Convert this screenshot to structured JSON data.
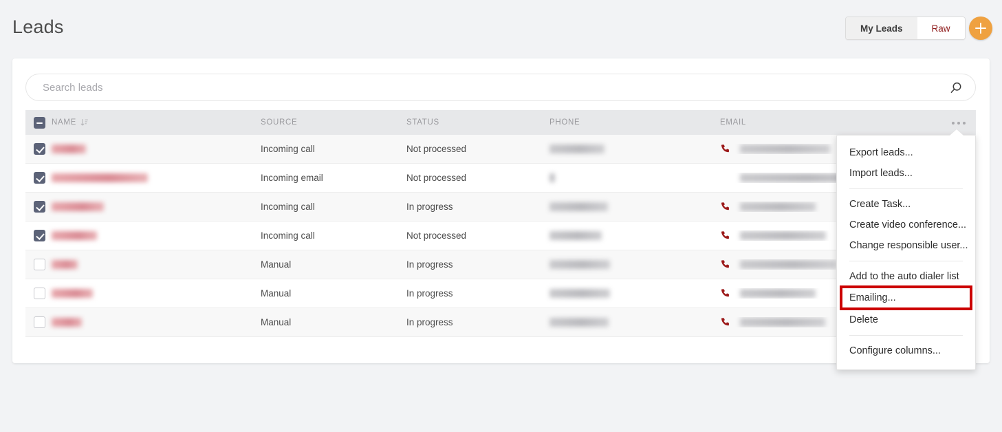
{
  "header": {
    "title": "Leads",
    "toggle": {
      "options": [
        "My Leads",
        "Raw"
      ],
      "selected": "My Leads"
    },
    "add_button_label": "+",
    "add_button_color": "#efa140",
    "raw_text_color": "#8e1a1a"
  },
  "search": {
    "placeholder": "Search leads",
    "value": "",
    "icon": "search-icon"
  },
  "table": {
    "columns": [
      "NAME",
      "SOURCE",
      "STATUS",
      "PHONE",
      "EMAIL"
    ],
    "sort_column": "NAME",
    "sort_icon": "sort-descending-icon",
    "header_checkbox_state": "indeterminate",
    "overflow_menu_icon": "ellipsis-icon",
    "rows": [
      {
        "checked": true,
        "name": "[redacted]",
        "name_width": 50,
        "source": "Incoming call",
        "status": "Not processed",
        "phone": "[redacted]",
        "phone_width": 80,
        "has_phone_icon": true,
        "email": "[redacted]",
        "email_width": 131
      },
      {
        "checked": true,
        "name": "[redacted]",
        "name_width": 140,
        "source": "Incoming email",
        "status": "Not processed",
        "phone": "",
        "phone_width": 8,
        "has_phone_icon": false,
        "email": "[redacted]",
        "email_width": 178
      },
      {
        "checked": true,
        "name": "[redacted]",
        "name_width": 76,
        "source": "Incoming call",
        "status": "In progress",
        "phone": "[redacted]",
        "phone_width": 85,
        "has_phone_icon": true,
        "email": "[redacted]",
        "email_width": 110
      },
      {
        "checked": true,
        "name": "[redacted]",
        "name_width": 66,
        "source": "Incoming call",
        "status": "Not processed",
        "phone": "[redacted]",
        "phone_width": 76,
        "has_phone_icon": true,
        "email": "[redacted]",
        "email_width": 125
      },
      {
        "checked": false,
        "name": "[redacted]",
        "name_width": 38,
        "source": "Manual",
        "status": "In progress",
        "phone": "[redacted]",
        "phone_width": 88,
        "has_phone_icon": true,
        "email": "[redacted]",
        "email_width": 140
      },
      {
        "checked": false,
        "name": "[redacted]",
        "name_width": 60,
        "source": "Manual",
        "status": "In progress",
        "phone": "[redacted]",
        "phone_width": 88,
        "has_phone_icon": true,
        "email": "[redacted]",
        "email_width": 110
      },
      {
        "checked": false,
        "name": "[redacted]",
        "name_width": 44,
        "source": "Manual",
        "status": "In progress",
        "phone": "[redacted]",
        "phone_width": 86,
        "has_phone_icon": true,
        "email": "[redacted]",
        "email_width": 124
      }
    ]
  },
  "context_menu": {
    "groups": [
      {
        "items": [
          {
            "label": "Export leads...",
            "highlighted": false
          },
          {
            "label": "Import leads...",
            "highlighted": false
          }
        ]
      },
      {
        "items": [
          {
            "label": "Create Task...",
            "highlighted": false
          },
          {
            "label": "Create video conference...",
            "highlighted": false
          },
          {
            "label": "Change responsible user...",
            "highlighted": false
          }
        ]
      },
      {
        "items": [
          {
            "label": "Add to the auto dialer list",
            "highlighted": false
          },
          {
            "label": "Emailing...",
            "highlighted": true
          },
          {
            "label": "Delete",
            "highlighted": false
          }
        ]
      },
      {
        "items": [
          {
            "label": "Configure columns...",
            "highlighted": false
          }
        ]
      }
    ],
    "highlight_color": "#cc0000"
  },
  "colors": {
    "page_background": "#f2f3f5",
    "card_background": "#ffffff",
    "table_header_background": "#e7e8ea",
    "checkbox_checked": "#5c6378",
    "phone_icon": "#9c1a1a",
    "accent_orange": "#efa140"
  }
}
